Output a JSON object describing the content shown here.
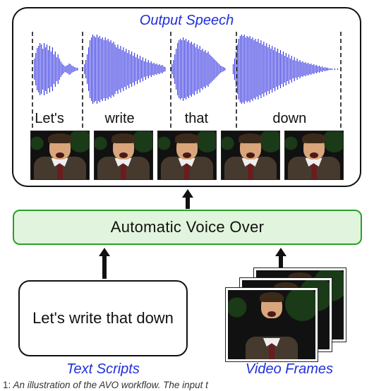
{
  "output": {
    "title": "Output Speech",
    "words": [
      "Let's",
      "write",
      "that",
      "down"
    ],
    "word_widths_pct": [
      16,
      27,
      20,
      37
    ],
    "dashed_dividers_pct": [
      2.5,
      18,
      45,
      65,
      97
    ],
    "frame_count": 5
  },
  "avo": {
    "label": "Automatic Voice Over"
  },
  "inputs": {
    "text_script": "Let's write that down",
    "text_label": "Text Scripts",
    "video_label": "Video Frames",
    "video_frame_count": 3
  },
  "caption": {
    "fignum": "1:",
    "text": "An illustration of the AVO workflow. The input t"
  },
  "colors": {
    "accent_blue": "#1f2fdc",
    "avo_fill": "#e1f4dd",
    "avo_border": "#2aa02a",
    "waveform": "#2a2ae0"
  }
}
